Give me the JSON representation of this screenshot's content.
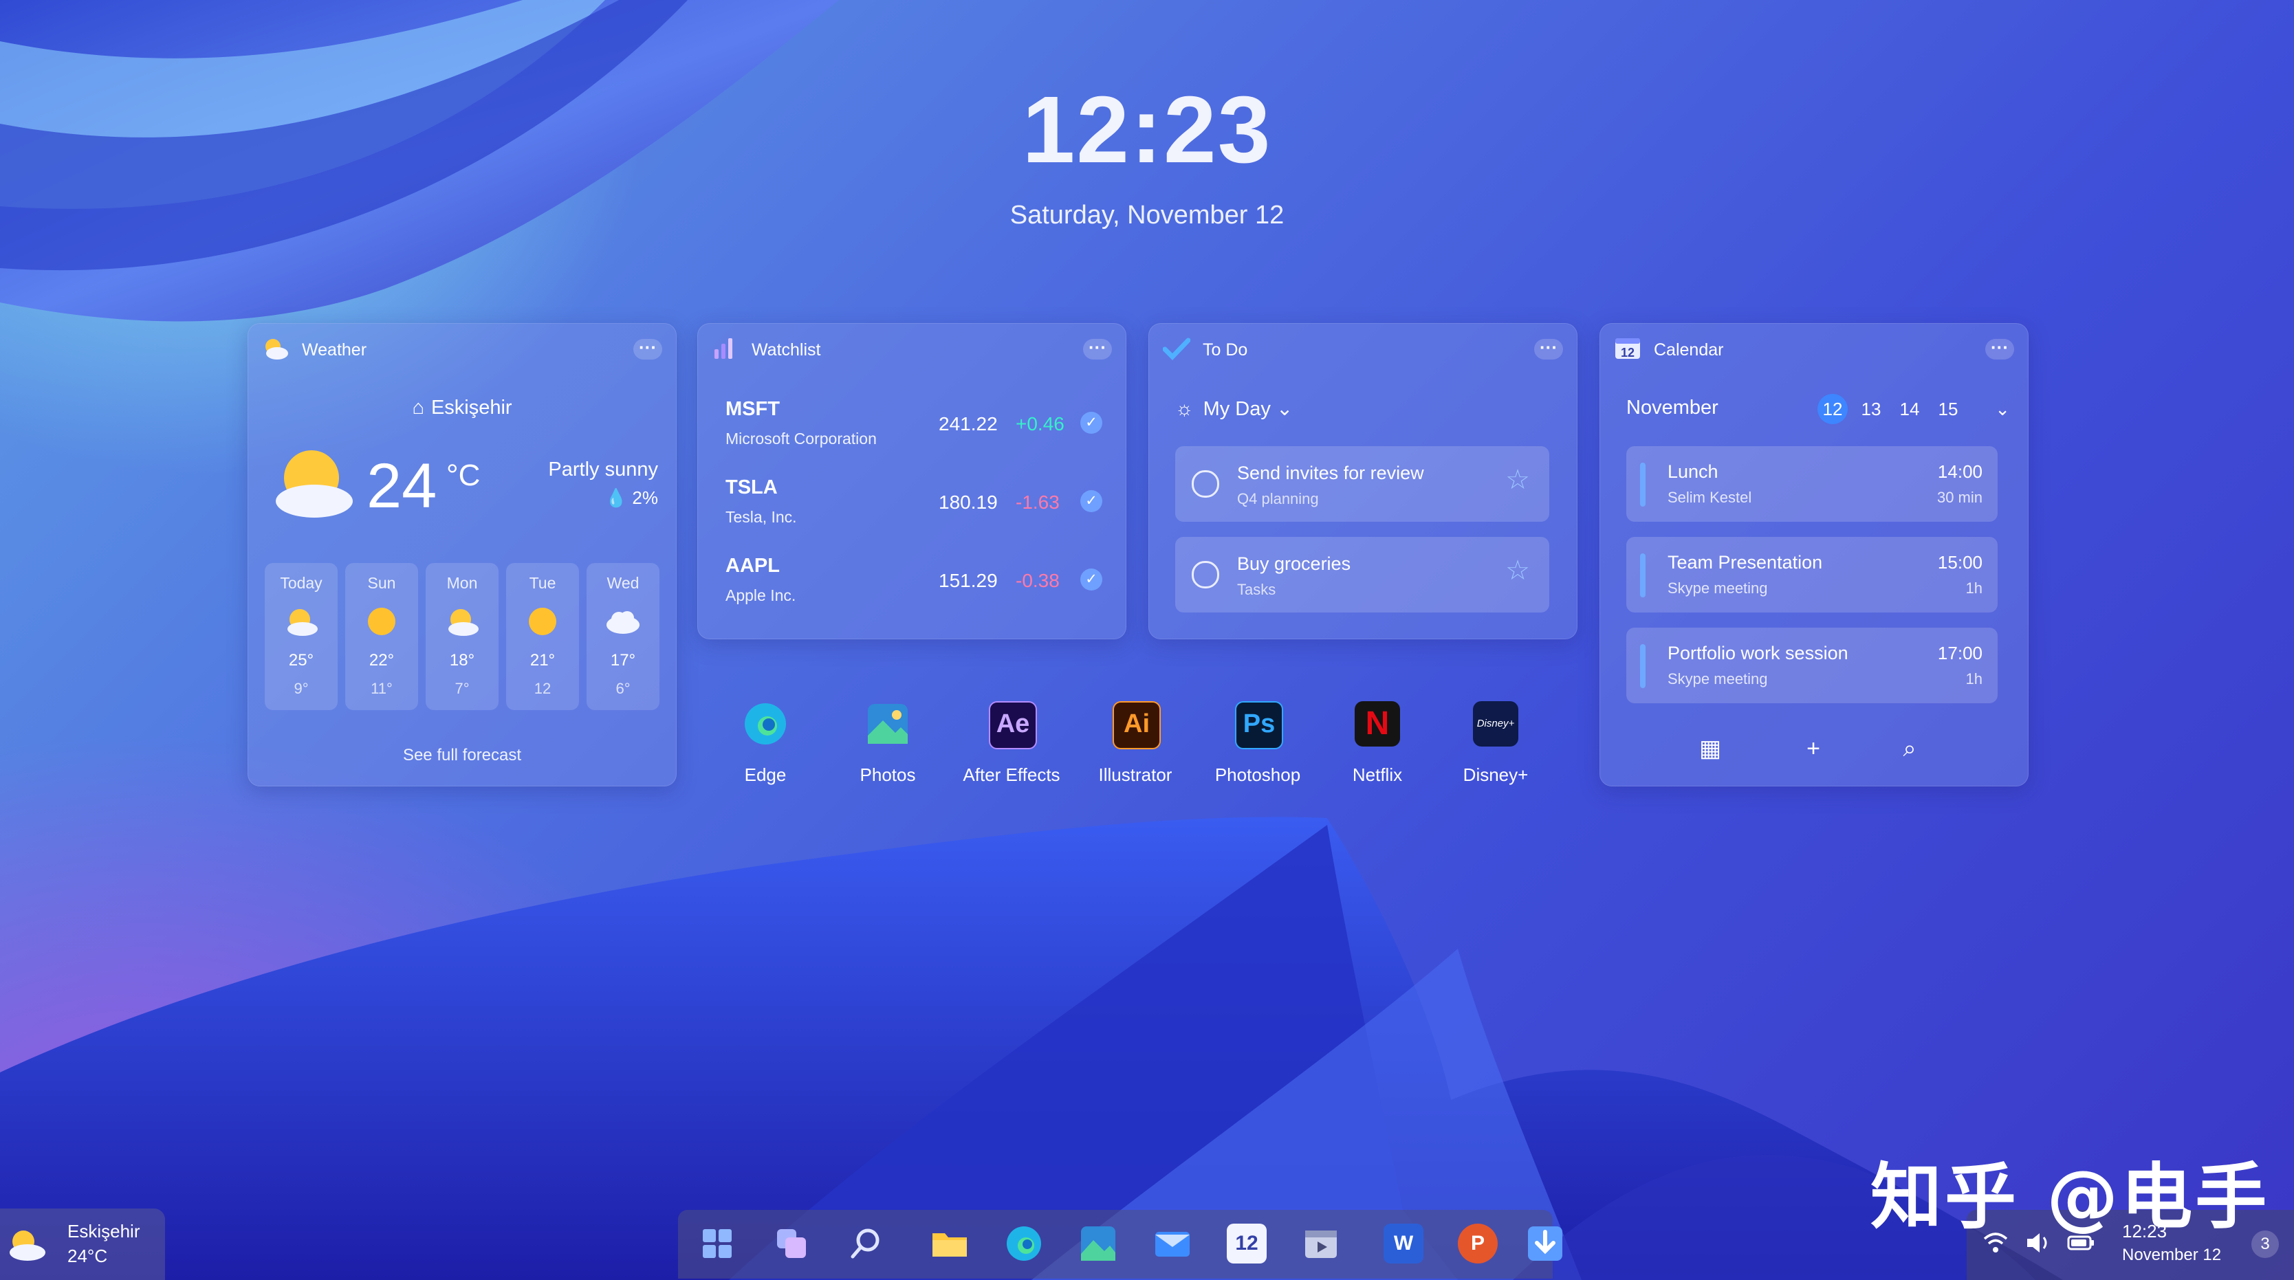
{
  "colors": {
    "accent": "#3d86ff",
    "positive": "#35f0c8",
    "negative": "#ff7aa8"
  },
  "lock": {
    "time": "12:23",
    "date": "Saturday, November 12"
  },
  "weather": {
    "title": "Weather",
    "icon": "partly-sunny-icon",
    "city": "Eskişehir",
    "temp": "24",
    "unit": "°C",
    "condition": "Partly sunny",
    "precip": "2%",
    "days": [
      {
        "name": "Today",
        "icon": "partly-sunny-icon",
        "hi": "25°",
        "lo": "9°"
      },
      {
        "name": "Sun",
        "icon": "sun-icon",
        "hi": "22°",
        "lo": "11°"
      },
      {
        "name": "Mon",
        "icon": "partly-sunny-icon",
        "hi": "18°",
        "lo": "7°"
      },
      {
        "name": "Tue",
        "icon": "sun-icon",
        "hi": "21°",
        "lo": "12"
      },
      {
        "name": "Wed",
        "icon": "cloud-icon",
        "hi": "17°",
        "lo": "6°"
      }
    ],
    "see_full": "See full forecast"
  },
  "watchlist": {
    "title": "Watchlist",
    "stocks": [
      {
        "symbol": "MSFT",
        "name": "Microsoft Corporation",
        "price": "241.22",
        "change": "+0.46"
      },
      {
        "symbol": "TSLA",
        "name": "Tesla, Inc.",
        "price": "180.19",
        "change": "-1.63"
      },
      {
        "symbol": "AAPL",
        "name": "Apple Inc.",
        "price": "151.29",
        "change": "-0.38"
      }
    ]
  },
  "todo": {
    "title": "To Do",
    "list": "My Day",
    "tasks": [
      {
        "title": "Send invites for review",
        "subtitle": "Q4 planning"
      },
      {
        "title": "Buy groceries",
        "subtitle": "Tasks"
      }
    ]
  },
  "calendar": {
    "title": "Calendar",
    "icon_day": "12",
    "month": "November",
    "days": [
      "12",
      "13",
      "14",
      "15"
    ],
    "events": [
      {
        "title": "Lunch",
        "subtitle": "Selim Kestel",
        "time": "14:00",
        "duration": "30 min"
      },
      {
        "title": "Team Presentation",
        "subtitle": "Skype meeting",
        "time": "15:00",
        "duration": "1h"
      },
      {
        "title": "Portfolio work session",
        "subtitle": "Skype meeting",
        "time": "17:00",
        "duration": "1h"
      }
    ]
  },
  "apps": [
    {
      "label": "Edge",
      "icon": "edge-icon"
    },
    {
      "label": "Photos",
      "icon": "photos-icon"
    },
    {
      "label": "After Effects",
      "icon": "after-effects-icon",
      "glyph": "Ae"
    },
    {
      "label": "Illustrator",
      "icon": "illustrator-icon",
      "glyph": "Ai"
    },
    {
      "label": "Photoshop",
      "icon": "photoshop-icon",
      "glyph": "Ps"
    },
    {
      "label": "Netflix",
      "icon": "netflix-icon",
      "glyph": "N"
    },
    {
      "label": "Disney+",
      "icon": "disney-plus-icon",
      "glyph": "Disney+"
    }
  ],
  "taskbar": {
    "weather_city": "Eskişehir",
    "weather_temp": "24°C",
    "calendar_day": "12",
    "word_glyph": "W",
    "ppt_glyph": "P",
    "clock_time": "12:23",
    "clock_date": "November 12",
    "notifications": "3"
  },
  "watermark": "知乎 @电手"
}
